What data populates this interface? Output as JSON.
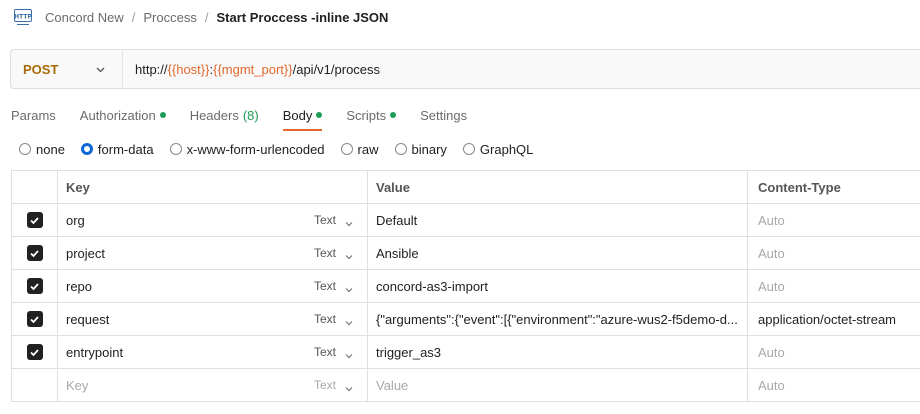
{
  "breadcrumb": {
    "items": [
      "Concord New",
      "Proccess"
    ],
    "current": "Start Proccess -inline JSON"
  },
  "request": {
    "method": "POST",
    "url_parts": [
      {
        "text": "http://",
        "kind": "plain"
      },
      {
        "text": "{{host}}",
        "kind": "var"
      },
      {
        "text": ":",
        "kind": "plain"
      },
      {
        "text": "{{mgmt_port}}",
        "kind": "var"
      },
      {
        "text": "/api/v1/process",
        "kind": "plain"
      }
    ]
  },
  "tabs": [
    {
      "label": "Params",
      "dot": false,
      "count": "",
      "active": false
    },
    {
      "label": "Authorization",
      "dot": true,
      "count": "",
      "active": false
    },
    {
      "label": "Headers",
      "dot": false,
      "count": "(8)",
      "active": false
    },
    {
      "label": "Body",
      "dot": true,
      "count": "",
      "active": true
    },
    {
      "label": "Scripts",
      "dot": true,
      "count": "",
      "active": false
    },
    {
      "label": "Settings",
      "dot": false,
      "count": "",
      "active": false
    }
  ],
  "body_types": [
    {
      "label": "none",
      "selected": false
    },
    {
      "label": "form-data",
      "selected": true
    },
    {
      "label": "x-www-form-urlencoded",
      "selected": false
    },
    {
      "label": "raw",
      "selected": false
    },
    {
      "label": "binary",
      "selected": false
    },
    {
      "label": "GraphQL",
      "selected": false
    }
  ],
  "table": {
    "headers": {
      "key": "Key",
      "value": "Value",
      "content_type": "Content-Type"
    },
    "rows": [
      {
        "checked": true,
        "key": "org",
        "type": "Text",
        "value": "Default",
        "content_type": "Auto"
      },
      {
        "checked": true,
        "key": "project",
        "type": "Text",
        "value": "Ansible",
        "content_type": "Auto"
      },
      {
        "checked": true,
        "key": "repo",
        "type": "Text",
        "value": "concord-as3-import",
        "content_type": "Auto"
      },
      {
        "checked": true,
        "key": "request",
        "type": "Text",
        "value": "{\"arguments\":{\"event\":[{\"environment\":\"azure-wus2-f5demo-d...",
        "content_type": "application/octet-stream"
      },
      {
        "checked": true,
        "key": "entrypoint",
        "type": "Text",
        "value": "trigger_as3",
        "content_type": "Auto"
      }
    ],
    "empty_row": {
      "key_placeholder": "Key",
      "type": "Text",
      "value_placeholder": "Value",
      "content_type": "Auto"
    }
  },
  "colors": {
    "accent": "#e2682c",
    "method": "#a86a06",
    "status_dot": "#1f9d55",
    "radio_selected": "#1166d6"
  }
}
